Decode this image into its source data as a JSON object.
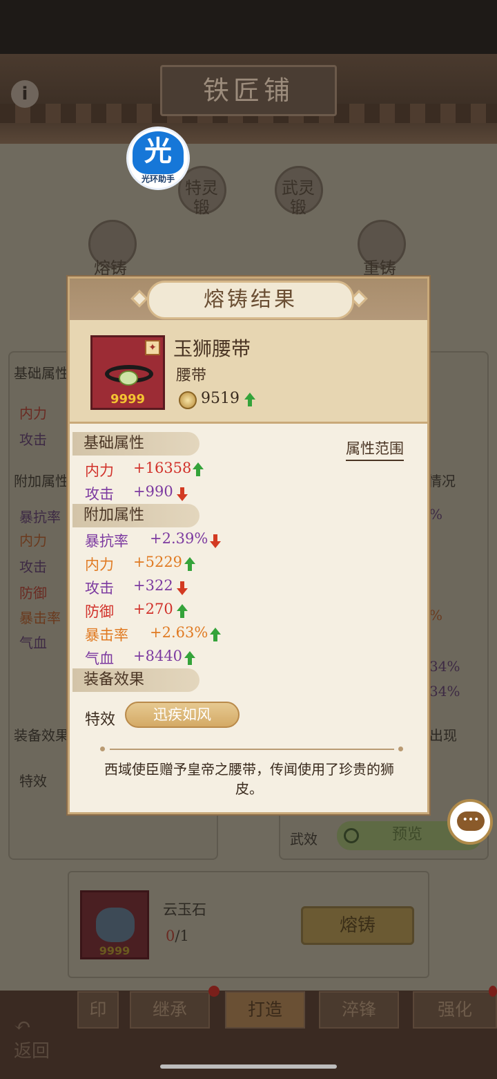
{
  "header": {
    "title": "铁匠铺",
    "info_icon": "info-icon"
  },
  "helper": {
    "glyph": "光",
    "caption": "光环助手"
  },
  "background": {
    "circle_labels": [
      "熔铸",
      "特灵锻",
      "武灵锻",
      "重铸"
    ],
    "left_panel": {
      "base_title": "基础属性",
      "base_rows": [
        "内力",
        "攻击"
      ],
      "extra_title": "附加属性",
      "extra_rows": [
        "暴抗率",
        "内力",
        "攻击",
        "防御",
        "暴击率",
        "气血"
      ],
      "effect_title": "装备效果",
      "effect_label": "特效"
    },
    "right_panel": {
      "texts": [
        "情况",
        "%",
        "%",
        "34%",
        "34%",
        "出现"
      ],
      "wuxiao_label": "武效",
      "preview_label": "预览"
    }
  },
  "dialog": {
    "title": "熔铸结果",
    "item": {
      "name": "玉狮腰带",
      "type": "腰带",
      "level": "9999",
      "power": "9519",
      "power_trend": "up"
    },
    "range_button": "属性范围",
    "base_section": "基础属性",
    "base_attrs": [
      {
        "label": "内力",
        "value": "+16358",
        "trend": "up",
        "color": "#d1312a"
      },
      {
        "label": "攻击",
        "value": "+990",
        "trend": "down",
        "color": "#7c3aa0"
      }
    ],
    "extra_section": "附加属性",
    "extra_attrs": [
      {
        "label": "暴抗率",
        "value": "+2.39%",
        "trend": "down",
        "color": "#7c3aa0"
      },
      {
        "label": "内力",
        "value": "+5229",
        "trend": "up",
        "color": "#e07a22"
      },
      {
        "label": "攻击",
        "value": "+322",
        "trend": "down",
        "color": "#7c3aa0"
      },
      {
        "label": "防御",
        "value": "+270",
        "trend": "up",
        "color": "#d1312a"
      },
      {
        "label": "暴击率",
        "value": "+2.63%",
        "trend": "up",
        "color": "#e07a22"
      },
      {
        "label": "气血",
        "value": "+8440",
        "trend": "up",
        "color": "#7c3aa0"
      }
    ],
    "effect_section": "装备效果",
    "effect_label": "特效",
    "effect_value": "迅疾如风",
    "description": "西域使臣赠予皇帝之腰带，传闻使用了珍贵的狮皮。"
  },
  "material": {
    "name": "云玉石",
    "have": "0",
    "need": "/1",
    "level": "9999",
    "forge_button": "熔铸"
  },
  "tabs": [
    {
      "label": "印",
      "active": false
    },
    {
      "label": "继承",
      "active": false
    },
    {
      "label": "打造",
      "active": true
    },
    {
      "label": "淬锋",
      "active": false
    },
    {
      "label": "强化",
      "active": false
    }
  ],
  "back_label": "返回",
  "colors": {
    "up": "#34a33a",
    "down": "#d33a22",
    "accent": "#c9a979"
  }
}
